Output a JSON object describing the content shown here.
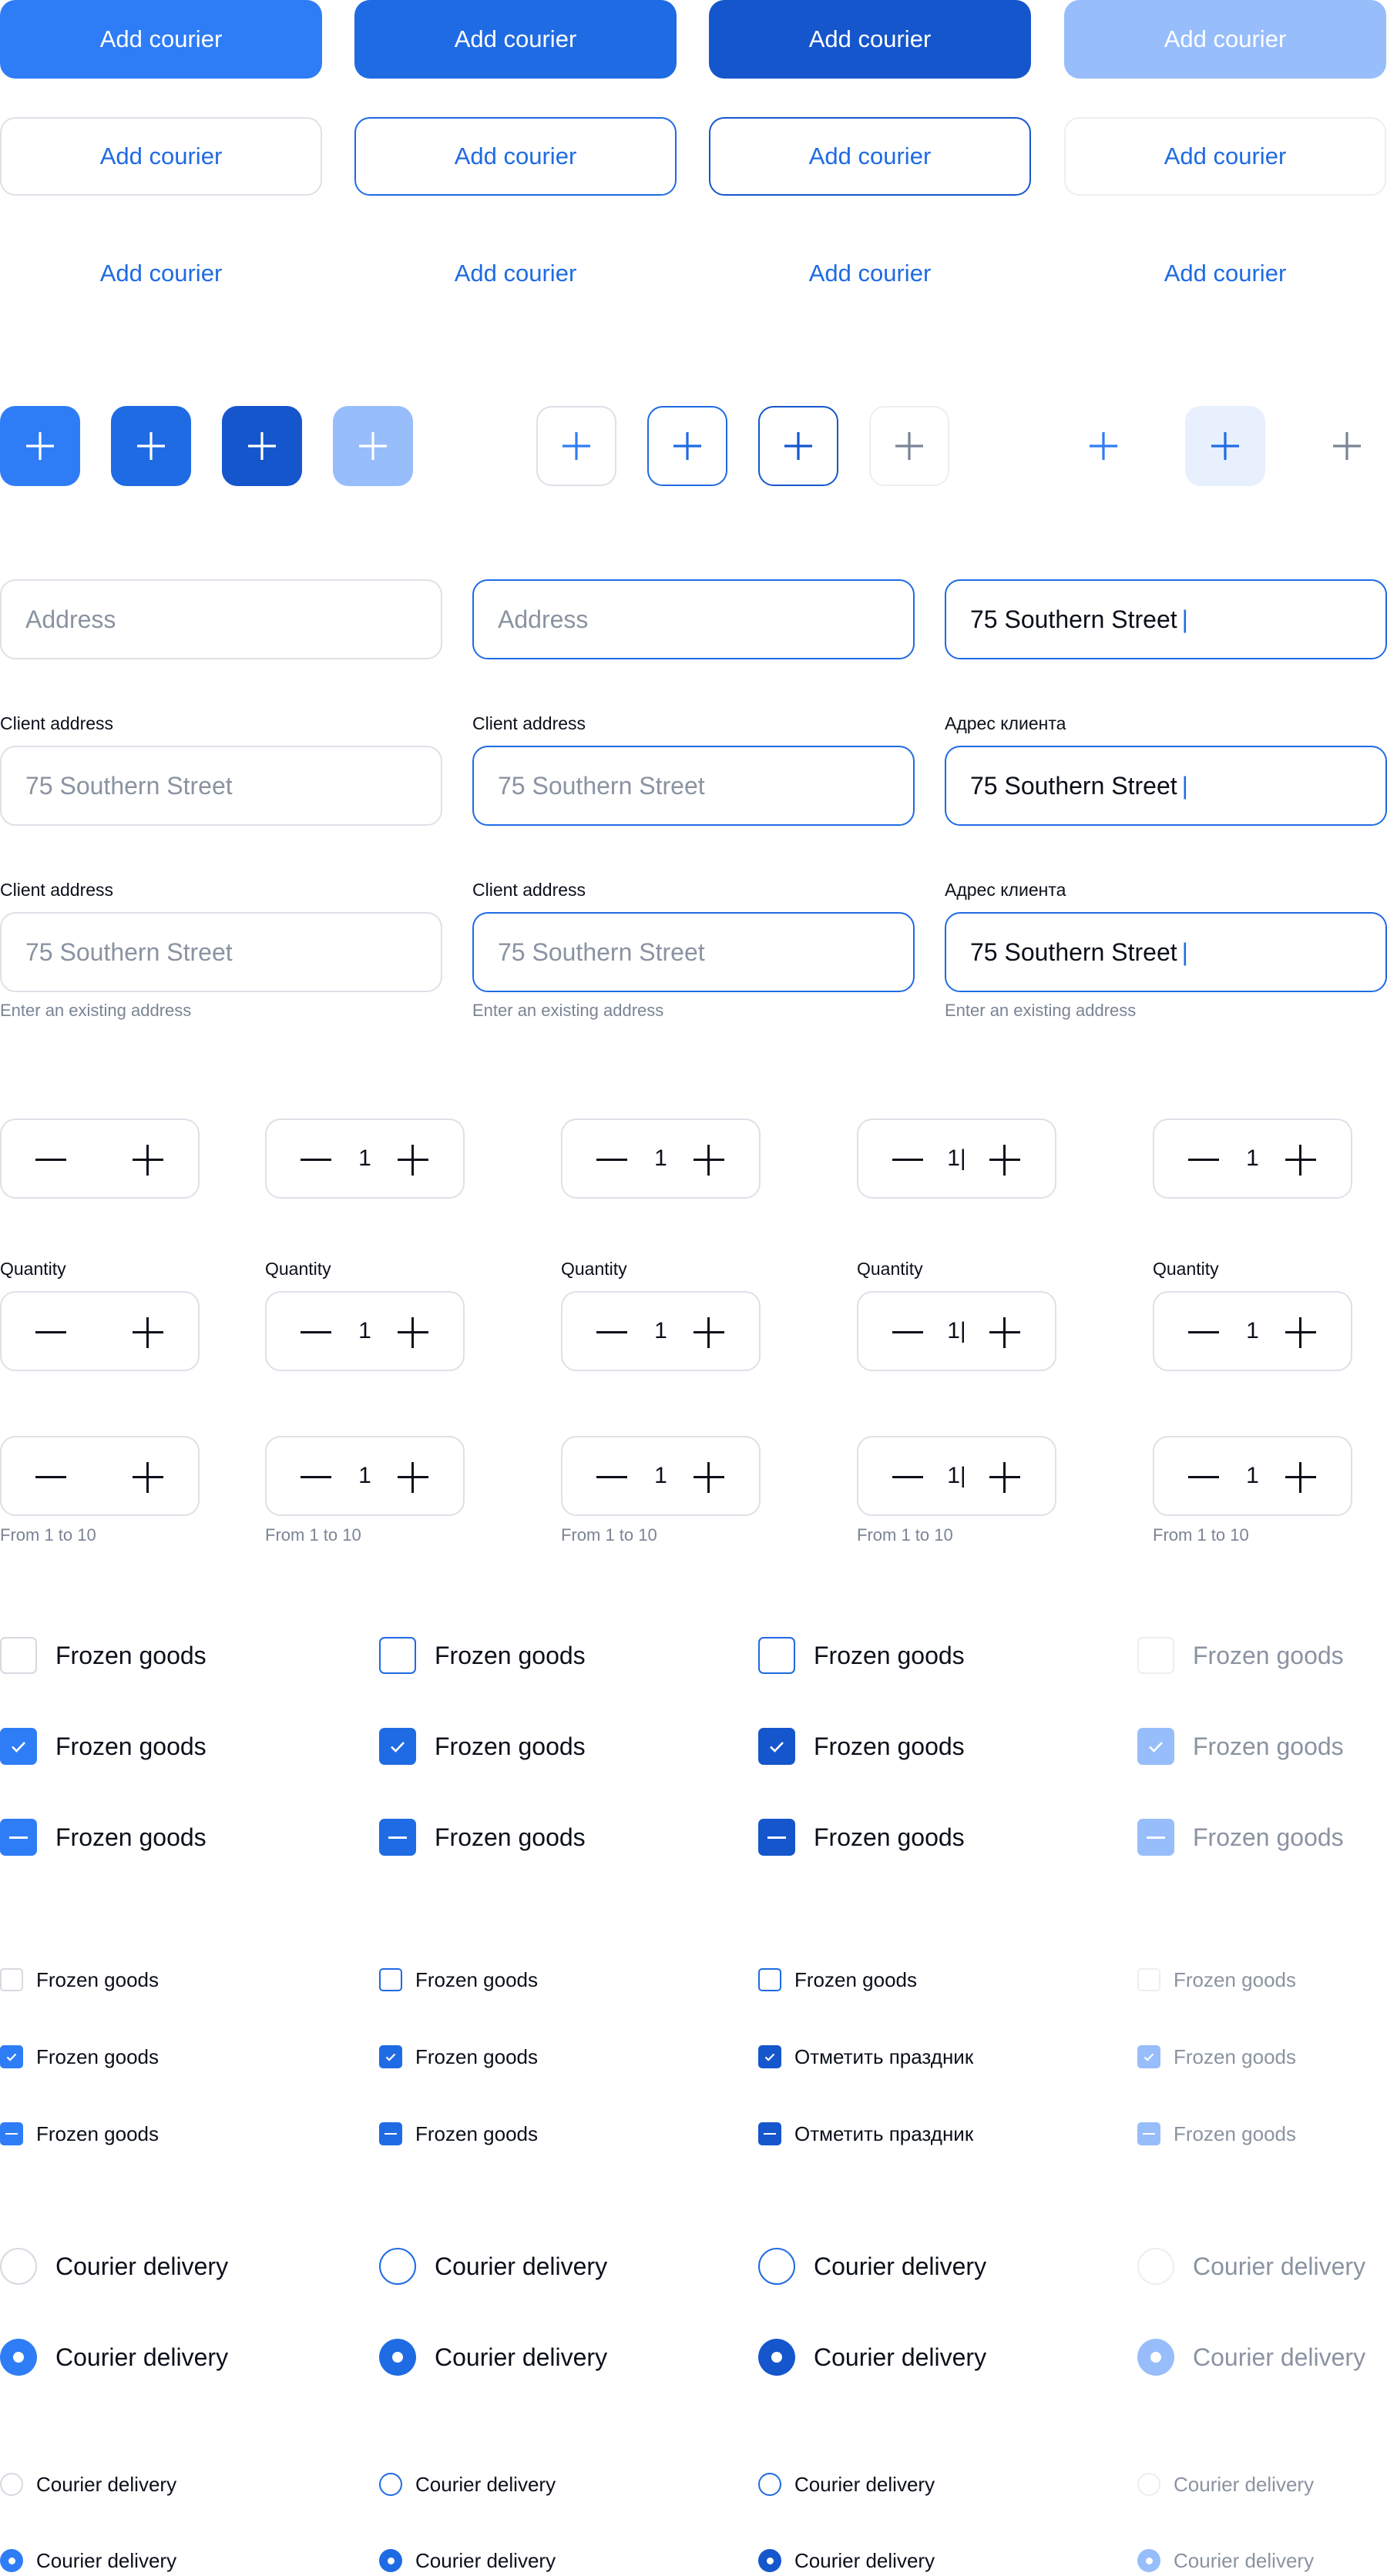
{
  "buttons": {
    "primary": [
      "Add courier",
      "Add courier",
      "Add courier",
      "Add courier"
    ],
    "outline": [
      "Add courier",
      "Add courier",
      "Add courier",
      "Add courier"
    ],
    "ghost": [
      "Add courier",
      "Add courier",
      "Add courier",
      "Add courier"
    ]
  },
  "icon_buttons": {
    "icon": "plus-icon",
    "count": 11
  },
  "inputs": {
    "row1": {
      "placeholder_default": "Address",
      "placeholder_hover": "Address",
      "active_value": "75 Southern Street",
      "caret": "|"
    },
    "row2": {
      "label_default": "Client address",
      "label_hover": "Client address",
      "label_active": "Адрес клиента",
      "value_default": "75 Southern Street",
      "value_hover": "75 Southern Street",
      "value_active": "75 Southern Street",
      "caret": "|"
    },
    "row3": {
      "label_default": "Client address",
      "label_hover": "Client address",
      "label_active": "Адрес клиента",
      "value_default": "75 Southern Street",
      "value_hover": "75 Southern Street",
      "value_active": "75 Southern Street",
      "caret": "|",
      "hint_default": "Enter an existing address",
      "hint_hover": "Enter an existing address",
      "hint_active": "Enter an existing address"
    }
  },
  "steppers": {
    "values": [
      "",
      "1",
      "1",
      "1|",
      "1"
    ],
    "label": "Quantity",
    "hint": "From 1 to 10"
  },
  "checkboxes_large": {
    "labels": [
      [
        "Frozen goods",
        "Frozen goods",
        "Frozen goods",
        "Frozen goods"
      ],
      [
        "Frozen goods",
        "Frozen goods",
        "Frozen goods",
        "Frozen goods"
      ],
      [
        "Frozen goods",
        "Frozen goods",
        "Frozen goods",
        "Frozen goods"
      ]
    ]
  },
  "checkboxes_small": {
    "labels": [
      [
        "Frozen goods",
        "Frozen goods",
        "Frozen goods",
        "Frozen goods"
      ],
      [
        "Frozen goods",
        "Frozen goods",
        "Отметить праздник",
        "Frozen goods"
      ],
      [
        "Frozen goods",
        "Frozen goods",
        "Отметить праздник",
        "Frozen goods"
      ]
    ]
  },
  "radios_large": {
    "labels": [
      [
        "Courier delivery",
        "Courier delivery",
        "Courier delivery",
        "Courier delivery"
      ],
      [
        "Courier delivery",
        "Courier delivery",
        "Courier delivery",
        "Courier delivery"
      ]
    ]
  },
  "radios_small": {
    "labels": [
      [
        "Courier delivery",
        "Courier delivery",
        "Courier delivery",
        "Courier delivery"
      ],
      [
        "Courier delivery",
        "Courier delivery",
        "Courier delivery",
        "Courier delivery"
      ]
    ]
  },
  "colors": {
    "primary": "#2f7df6",
    "hover": "#1f6be3",
    "pressed": "#1656cc",
    "disabled": "#97bdfb",
    "border": "#dde1e7",
    "muted_text": "#7a8494"
  }
}
